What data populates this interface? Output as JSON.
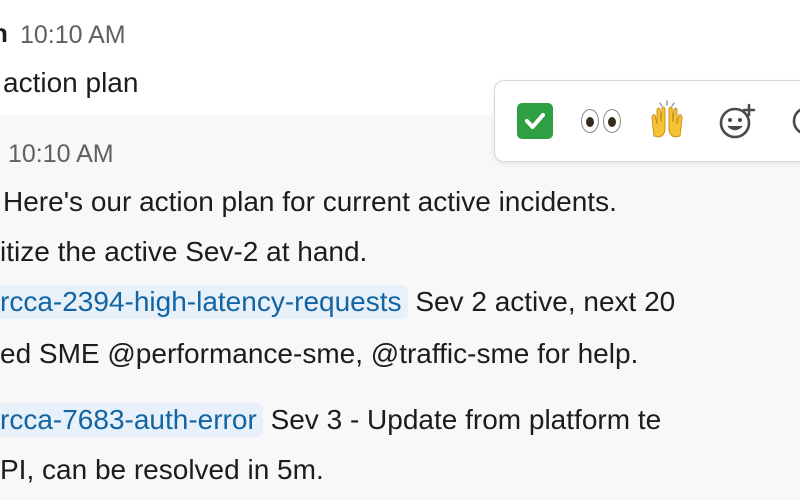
{
  "message_1": {
    "sender_fragment": "n",
    "timestamp": "10:10 AM",
    "text": "action plan"
  },
  "message_2": {
    "sender_fragment": "",
    "timestamp": "10:10 AM",
    "line1": "Here's our action plan for current active incidents.",
    "line2": "itize the active Sev-2 at hand.",
    "item1": {
      "channel": "rcca-2394-high-latency-requests",
      "text": "Sev 2 active, next 20",
      "cont": "ed SME @performance-sme, @traffic-sme for help."
    },
    "item2": {
      "channel": "rcca-7683-auth-error",
      "text": "Sev 3 - Update from platform te",
      "cont": "PI, can be resolved in 5m."
    }
  },
  "toolbar": {
    "reactions": [
      "white-check-mark",
      "eyes",
      "raised-hands",
      "add-reaction",
      "more"
    ]
  },
  "colors": {
    "link": "#1264a3",
    "channel_bg": "#e8f1f9",
    "hover_bg": "#f8f8f8",
    "meta": "#616061",
    "check_green": "#2ea043"
  }
}
